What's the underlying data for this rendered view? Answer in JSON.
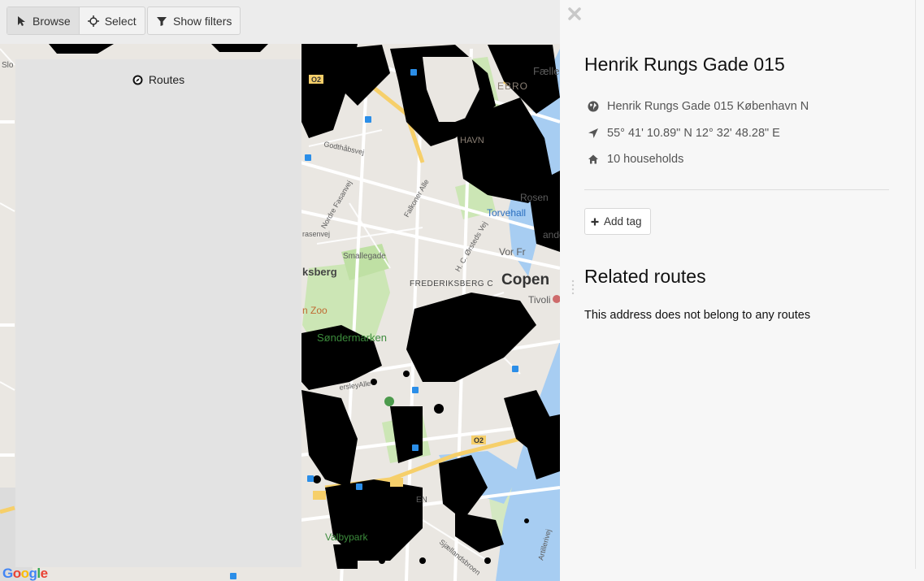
{
  "toolbar": {
    "browse_label": "Browse",
    "select_label": "Select",
    "show_filters_label": "Show filters"
  },
  "routes_panel": {
    "title": "Routes"
  },
  "map": {
    "logo": "Google",
    "labels": {
      "faelled": "Fælled",
      "ebro": "EBRO",
      "havn": "HAVN",
      "godthabsvej": "Godthåbsvej",
      "nordre_fasanvej": "Nordre Fasanvej",
      "falkoner_alle": "Falkoner Alle",
      "hc_orsteds_vej": "H. C. Ørsteds Vej",
      "rosen": "Rosen",
      "torvehall": "Torvehall",
      "ande": "ande",
      "vorre": "Vor Fr",
      "smallegade": "Smallegade",
      "rasenvej": "rasenvej",
      "ksberg": "ksberg",
      "frederiksberg_c": "FREDERIKSBERG C",
      "copen": "Copen",
      "tivoli": "Tivoli",
      "zoo": "n Zoo",
      "sondermarken": "Søndermarken",
      "ersleyalle": "ersleyAlle",
      "valbypark": "Valbypark",
      "sjaelandsbroen": "Sjællandsbroen",
      "artillerivej": "Artillerivej",
      "en": "EN",
      "slo": "Slo",
      "o2": "O2"
    },
    "colors": {
      "land": "#eae7e2",
      "road": "#ffffff",
      "major_road": "#f6cf6a",
      "park": "#cce6b5",
      "water": "#a7cdf2",
      "dots": "#000000"
    }
  },
  "detail": {
    "title": "Henrik Rungs Gade 015",
    "address": "Henrik Rungs Gade 015 København N",
    "coordinates": "55° 41' 10.89\" N 12° 32' 48.28\" E",
    "households": "10 households",
    "add_tag_label": "Add tag",
    "related_title": "Related routes",
    "related_empty": "This address does not belong to any routes",
    "icons": {
      "address": "globe-icon",
      "coordinates": "location-arrow-icon",
      "households": "home-icon",
      "add_tag": "plus-icon",
      "close": "close-icon"
    }
  }
}
